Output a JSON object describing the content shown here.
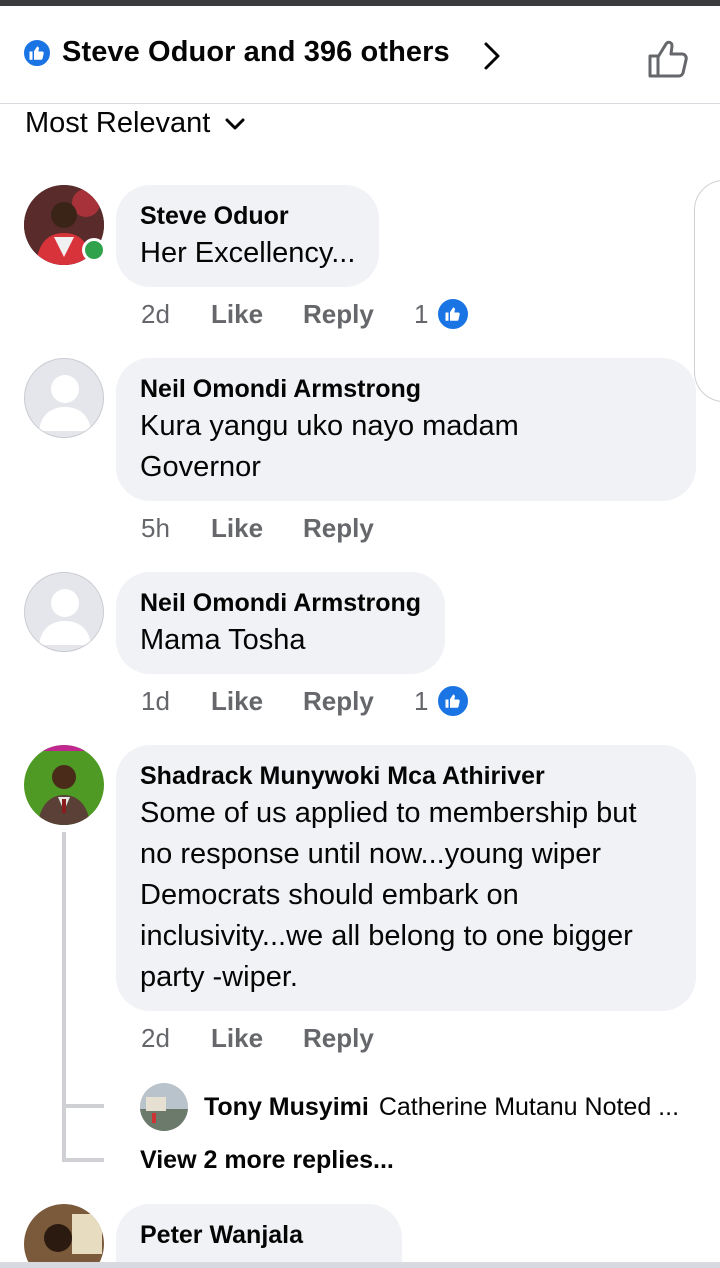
{
  "header": {
    "title": "Steve Oduor and 396 others",
    "reaction_icon": "like-reaction-icon",
    "chevron_icon": "chevron-right-icon",
    "like_icon": "thumbs-up-outline-icon"
  },
  "sort": {
    "label": "Most Relevant",
    "caret_icon": "chevron-down-icon"
  },
  "comments": [
    {
      "author": "Steve Oduor",
      "text": "Her Excellency...",
      "time": "2d",
      "like_label": "Like",
      "reply_label": "Reply",
      "reactions": "1",
      "online": true
    },
    {
      "author": "Neil Omondi Armstrong",
      "text": "Kura yangu uko nayo madam Governor",
      "time": "5h",
      "like_label": "Like",
      "reply_label": "Reply"
    },
    {
      "author": "Neil Omondi Armstrong",
      "text": "Mama Tosha",
      "time": "1d",
      "like_label": "Like",
      "reply_label": "Reply",
      "reactions": "1"
    },
    {
      "author": "Shadrack Munywoki Mca Athiriver",
      "text": "Some of us applied to membership but no response until now...young wiper Democrats should embark on inclusivity...we all belong to one bigger party -wiper.",
      "time": "2d",
      "like_label": "Like",
      "reply_label": "Reply"
    },
    {
      "author": "Peter Wanjala"
    }
  ],
  "reply_preview": {
    "author": "Tony Musyimi",
    "snippet": "Catherine Mutanu Noted ...",
    "more_label": "View 2 more replies..."
  },
  "colors": {
    "accent": "#1b74e4",
    "bubble": "#f0f2f5",
    "meta_text": "#65676b",
    "online": "#31a24c"
  }
}
